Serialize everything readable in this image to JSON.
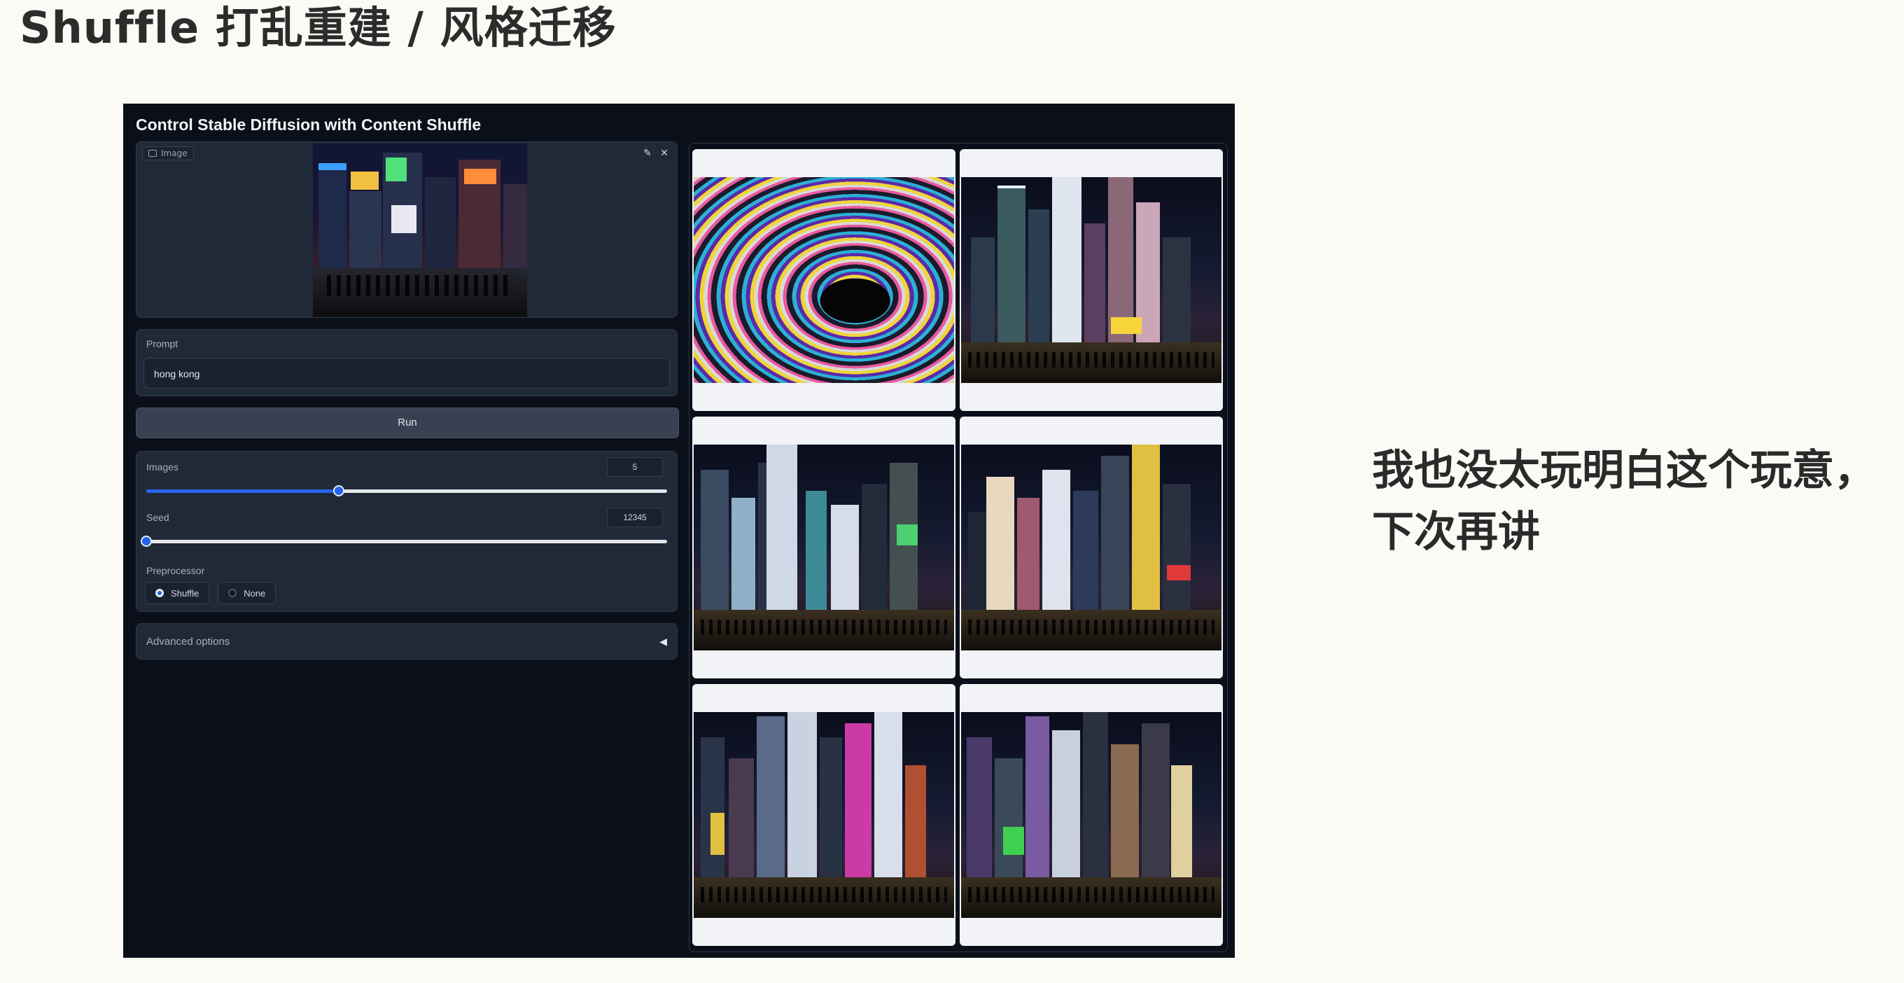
{
  "slide": {
    "title": "Shuffle 打乱重建 / 风格迁移",
    "note_line1": "我也没太玩明白这个玩意，",
    "note_line2": "下次再讲"
  },
  "app": {
    "title": "Control Stable Diffusion with Content Shuffle",
    "image_label": "Image",
    "prompt_label": "Prompt",
    "prompt_value": "hong kong",
    "run_label": "Run",
    "images_label": "Images",
    "images_value": "5",
    "images_fraction": 0.37,
    "seed_label": "Seed",
    "seed_value": "12345",
    "seed_fraction": 0.0,
    "preprocessor_label": "Preprocessor",
    "preprocessor_options": [
      "Shuffle",
      "None"
    ],
    "preprocessor_selected": "Shuffle",
    "advanced_label": "Advanced options"
  },
  "icons": {
    "edit": "pencil-icon",
    "close": "close-icon",
    "collapse": "triangle-left-icon",
    "image_tag": "image-icon"
  },
  "colors": {
    "app_bg": "#0b0f19",
    "accent": "#2563eb",
    "slide_bg": "#fcfaf5"
  }
}
